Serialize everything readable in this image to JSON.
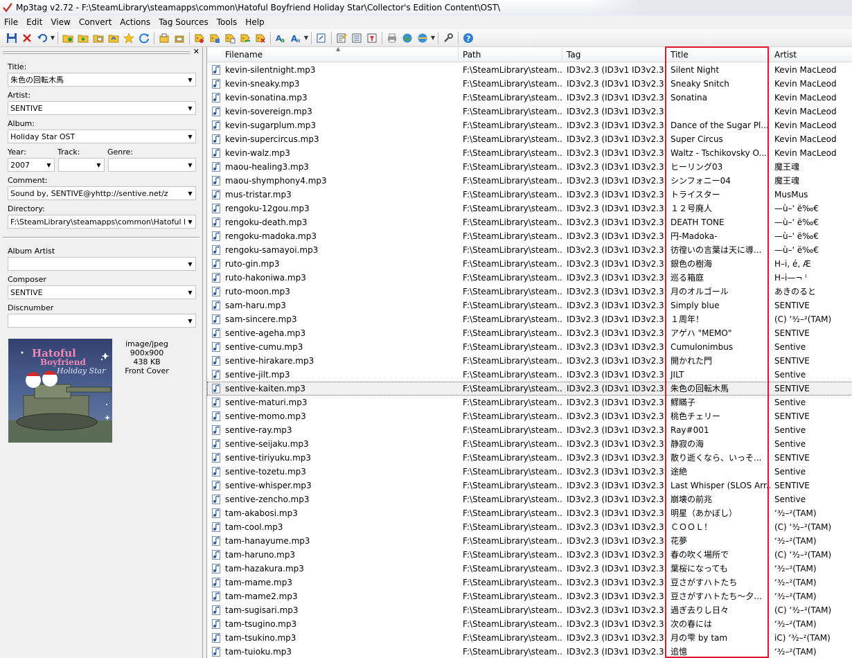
{
  "window": {
    "title": "Mp3tag v2.72  -  F:\\SteamLibrary\\steamapps\\common\\Hatoful Boyfriend Holiday Star\\Collector's Edition Content\\OST\\"
  },
  "menu": [
    "File",
    "Edit",
    "View",
    "Convert",
    "Actions",
    "Tag Sources",
    "Tools",
    "Help"
  ],
  "toolbar_icons": [
    "save-icon",
    "remove-tag-icon",
    "undo-icon",
    "add-directory-icon",
    "change-directory-icon",
    "add-files-icon",
    "favorite-icon",
    "refresh-icon",
    "copy-tag-icon",
    "paste-tag-icon",
    "tag-to-filename-icon",
    "filename-to-tag-icon",
    "text-to-tag-icon",
    "tag-to-tag-icon",
    "auto-numbering-icon",
    "actions-icon",
    "case-conversion-icon",
    "extended-tags-icon",
    "export-icon",
    "playlist-icon",
    "filter-icon",
    "print-icon",
    "web-source-icon",
    "freedb-icon",
    "options-icon",
    "help-icon"
  ],
  "colors": {
    "highlight": "#e0142c",
    "accent": "#1f6fd0"
  },
  "panel": {
    "title_label": "Title:",
    "title_value": "朱色の回転木馬",
    "artist_label": "Artist:",
    "artist_value": "SENTIVE",
    "album_label": "Album:",
    "album_value": "Holiday Star OST",
    "year_label": "Year:",
    "year_value": "2007",
    "track_label": "Track:",
    "track_value": "",
    "genre_label": "Genre:",
    "genre_value": "",
    "comment_label": "Comment:",
    "comment_value": "Sound by, SENTIVE@yhttp://sentive.net/z",
    "directory_label": "Directory:",
    "directory_value": "F:\\SteamLibrary\\steamapps\\common\\Hatoful Boyfriend",
    "album_artist_label": "Album Artist",
    "album_artist_value": "",
    "composer_label": "Composer",
    "composer_value": "SENTIVE",
    "discnumber_label": "Discnumber",
    "discnumber_value": "",
    "cover": {
      "type": "image/jpeg",
      "dimensions": "900x900",
      "size": "438 KB",
      "kind": "Front Cover",
      "art_text_1": "Hatoful",
      "art_text_2": "Boyfriend",
      "art_text_3": "Holiday Star"
    }
  },
  "columns": {
    "filename": "Filename",
    "path": "Path",
    "tag": "Tag",
    "title": "Title",
    "artist": "Artist"
  },
  "rows": [
    {
      "filename": "kevin-silentnight.mp3",
      "path": "F:\\SteamLibrary\\steam...",
      "tag": "ID3v2.3 (ID3v1 ID3v2.3)",
      "title": "Silent Night",
      "artist": "Kevin MacLeod"
    },
    {
      "filename": "kevin-sneaky.mp3",
      "path": "F:\\SteamLibrary\\steam...",
      "tag": "ID3v2.3 (ID3v1 ID3v2.3)",
      "title": "Sneaky Snitch",
      "artist": "Kevin MacLeod"
    },
    {
      "filename": "kevin-sonatina.mp3",
      "path": "F:\\SteamLibrary\\steam...",
      "tag": "ID3v2.3 (ID3v1 ID3v2.3)",
      "title": "Sonatina",
      "artist": "Kevin MacLeod"
    },
    {
      "filename": "kevin-sovereign.mp3",
      "path": "F:\\SteamLibrary\\steam...",
      "tag": "ID3v2.3 (ID3v1 ID3v2.3)",
      "title": "",
      "artist": "Kevin MacLeod"
    },
    {
      "filename": "kevin-sugarplum.mp3",
      "path": "F:\\SteamLibrary\\steam...",
      "tag": "ID3v2.3 (ID3v1 ID3v2.3...",
      "title": "Dance of the Sugar Pl...",
      "artist": "Kevin MacLeod"
    },
    {
      "filename": "kevin-supercircus.mp3",
      "path": "F:\\SteamLibrary\\steam...",
      "tag": "ID3v2.3 (ID3v1 ID3v2.3...",
      "title": "Super Circus",
      "artist": "Kevin MacLeod"
    },
    {
      "filename": "kevin-walz.mp3",
      "path": "F:\\SteamLibrary\\steam...",
      "tag": "ID3v2.3 (ID3v1 ID3v2.3)",
      "title": "Waltz - Tschikovsky O...",
      "artist": "Kevin MacLeod"
    },
    {
      "filename": "maou-healing3.mp3",
      "path": "F:\\SteamLibrary\\steam...",
      "tag": "ID3v2.3 (ID3v1 ID3v2.3)",
      "title": "ヒーリング03",
      "artist": "魔王魂"
    },
    {
      "filename": "maou-shymphony4.mp3",
      "path": "F:\\SteamLibrary\\steam...",
      "tag": "ID3v2.3 (ID3v1 ID3v2.3)",
      "title": "シンフォニー04",
      "artist": "魔王魂"
    },
    {
      "filename": "mus-tristar.mp3",
      "path": "F:\\SteamLibrary\\steam...",
      "tag": "ID3v2.3 (ID3v1 ID3v2.3)",
      "title": "トライスター",
      "artist": "MusMus"
    },
    {
      "filename": "rengoku-12gou.mp3",
      "path": "F:\\SteamLibrary\\steam...",
      "tag": "ID3v2.3 (ID3v1 ID3v2.3)",
      "title": "１２号廃人",
      "artist": "—ù–'  ë‰€"
    },
    {
      "filename": "rengoku-death.mp3",
      "path": "F:\\SteamLibrary\\steam...",
      "tag": "ID3v2.3 (ID3v1 ID3v2.3)",
      "title": "DEATH TONE",
      "artist": "—ù–'  ë‰€"
    },
    {
      "filename": "rengoku-madoka.mp3",
      "path": "F:\\SteamLibrary\\steam...",
      "tag": "ID3v2.3 (ID3v1 ID3v2.3)",
      "title": "円-Madoka-",
      "artist": "—ù–'  ë‰€"
    },
    {
      "filename": "rengoku-samayoi.mp3",
      "path": "F:\\SteamLibrary\\steam...",
      "tag": "ID3v2.3 (ID3v1 ID3v2.3)",
      "title": "彷徨いの言葉は天に導...",
      "artist": "—ù–'  ë‰€"
    },
    {
      "filename": "ruto-gin.mp3",
      "path": "F:\\SteamLibrary\\steam...",
      "tag": "ID3v2.3 (ID3v1 ID3v2.3)",
      "title": "銀色の樹海",
      "artist": "H–i, é, Æ"
    },
    {
      "filename": "ruto-hakoniwa.mp3",
      "path": "F:\\SteamLibrary\\steam...",
      "tag": "ID3v2.3 (ID3v1 ID3v2.3)",
      "title": "巡る箱庭",
      "artist": "H–i—¬  ˡ"
    },
    {
      "filename": "ruto-moon.mp3",
      "path": "F:\\SteamLibrary\\steam...",
      "tag": "ID3v2.3 (ID3v1 ID3v2.3)",
      "title": "月のオルゴール",
      "artist": "あきのると"
    },
    {
      "filename": "sam-haru.mp3",
      "path": "F:\\SteamLibrary\\steam...",
      "tag": "ID3v2.3 (ID3v1 ID3v2.3)",
      "title": "Simply blue",
      "artist": "SENTIVE"
    },
    {
      "filename": "sam-sincere.mp3",
      "path": "F:\\SteamLibrary\\steam...",
      "tag": "ID3v2.3 (ID3v1 ID3v2.3)",
      "title": "１周年！",
      "artist": "(C)  ʻ³⁄₂–²(TAM)"
    },
    {
      "filename": "sentive-ageha.mp3",
      "path": "F:\\SteamLibrary\\steam...",
      "tag": "ID3v2.3 (ID3v1 ID3v2.3)",
      "title": "アゲハ  \"MEMO\"",
      "artist": "SENTIVE"
    },
    {
      "filename": "sentive-cumu.mp3",
      "path": "F:\\SteamLibrary\\steam...",
      "tag": "ID3v2.3 (ID3v1 ID3v2.3)",
      "title": "Cumulonimbus",
      "artist": "Sentive"
    },
    {
      "filename": "sentive-hirakare.mp3",
      "path": "F:\\SteamLibrary\\steam...",
      "tag": "ID3v2.3 (ID3v1 ID3v2.3)",
      "title": "開かれた門",
      "artist": "SENTIVE"
    },
    {
      "filename": "sentive-jilt.mp3",
      "path": "F:\\SteamLibrary\\steam...",
      "tag": "ID3v2.3 (ID3v1 ID3v2.3)",
      "title": "JILT",
      "artist": "Sentive"
    },
    {
      "filename": "sentive-kaiten.mp3",
      "path": "F:\\SteamLibrary\\steam...",
      "tag": "ID3v2.3 (ID3v1 ID3v2.3)",
      "title": "朱色の回転木馬",
      "artist": "SENTIVE",
      "selected": true
    },
    {
      "filename": "sentive-maturi.mp3",
      "path": "F:\\SteamLibrary\\steam...",
      "tag": "ID3v2.3 (ID3v1 ID3v2.3)",
      "title": "鰥瞞子",
      "artist": "Sentive"
    },
    {
      "filename": "sentive-momo.mp3",
      "path": "F:\\SteamLibrary\\steam...",
      "tag": "ID3v2.3 (ID3v1 ID3v2.3)",
      "title": "桃色チェリー",
      "artist": "SENTIVE"
    },
    {
      "filename": "sentive-ray.mp3",
      "path": "F:\\SteamLibrary\\steam...",
      "tag": "ID3v2.3 (ID3v1 ID3v2.3)",
      "title": "Ray#001",
      "artist": "Sentive"
    },
    {
      "filename": "sentive-seijaku.mp3",
      "path": "F:\\SteamLibrary\\steam...",
      "tag": "ID3v2.3 (ID3v1 ID3v2.3)",
      "title": "静寂の海",
      "artist": "Sentive"
    },
    {
      "filename": "sentive-tiriyuku.mp3",
      "path": "F:\\SteamLibrary\\steam...",
      "tag": "ID3v2.3 (ID3v1 ID3v2.3)",
      "title": "散り逝くなら、いっそ...",
      "artist": "SENTIVE"
    },
    {
      "filename": "sentive-tozetu.mp3",
      "path": "F:\\SteamLibrary\\steam...",
      "tag": "ID3v2.3 (ID3v1 ID3v2.3)",
      "title": "途絶",
      "artist": "Sentive"
    },
    {
      "filename": "sentive-whisper.mp3",
      "path": "F:\\SteamLibrary\\steam...",
      "tag": "ID3v2.3 (ID3v1 ID3v2.3)",
      "title": "Last Whisper (SLOS Arr...",
      "artist": "SENTIVE"
    },
    {
      "filename": "sentive-zencho.mp3",
      "path": "F:\\SteamLibrary\\steam...",
      "tag": "ID3v2.3 (ID3v1 ID3v2.3)",
      "title": "崩壊の前兆",
      "artist": "Sentive"
    },
    {
      "filename": "tam-akabosi.mp3",
      "path": "F:\\SteamLibrary\\steam...",
      "tag": "ID3v2.3 (ID3v1 ID3v2.3)",
      "title": "明星（あかぼし）",
      "artist": "  ʻ³⁄₂–²(TAM)"
    },
    {
      "filename": "tam-cool.mp3",
      "path": "F:\\SteamLibrary\\steam...",
      "tag": "ID3v2.3 (ID3v1 ID3v2.3)",
      "title": "ＣＯＯＬ！",
      "artist": "(C)  ʻ³⁄₂–²(TAM)"
    },
    {
      "filename": "tam-hanayume.mp3",
      "path": "F:\\SteamLibrary\\steam...",
      "tag": "ID3v2.3 (ID3v1 ID3v2.3)",
      "title": "花夢",
      "artist": "  ʻ³⁄₂–²(TAM)"
    },
    {
      "filename": "tam-haruno.mp3",
      "path": "F:\\SteamLibrary\\steam...",
      "tag": "ID3v2.3 (ID3v1 ID3v2.3)",
      "title": "春の吹く場所で",
      "artist": "(C)  ʻ³⁄₂–²(TAM)"
    },
    {
      "filename": "tam-hazakura.mp3",
      "path": "F:\\SteamLibrary\\steam...",
      "tag": "ID3v2.3 (ID3v1 ID3v2.3)",
      "title": "葉桜になっても",
      "artist": "  ʻ³⁄₂–²(TAM)"
    },
    {
      "filename": "tam-mame.mp3",
      "path": "F:\\SteamLibrary\\steam...",
      "tag": "ID3v2.3 (ID3v1 ID3v2.3)",
      "title": "豆さがすハトたち",
      "artist": "  ʻ³⁄₂–²(TAM)"
    },
    {
      "filename": "tam-mame2.mp3",
      "path": "F:\\SteamLibrary\\steam...",
      "tag": "ID3v2.3 (ID3v1 ID3v2.3)",
      "title": "豆さがすハトたち～夕...",
      "artist": "  ʻ³⁄₂–²(TAM)"
    },
    {
      "filename": "tam-sugisari.mp3",
      "path": "F:\\SteamLibrary\\steam...",
      "tag": "ID3v2.3 (ID3v1 ID3v2.3)",
      "title": "過ぎ去りし日々",
      "artist": "(C)  ʻ³⁄₂–²(TAM)"
    },
    {
      "filename": "tam-tsugino.mp3",
      "path": "F:\\SteamLibrary\\steam...",
      "tag": "ID3v2.3 (ID3v1 ID3v2.3)",
      "title": "次の春には",
      "artist": "  ʻ³⁄₂–²(TAM)"
    },
    {
      "filename": "tam-tsukino.mp3",
      "path": "F:\\SteamLibrary\\steam...",
      "tag": "ID3v2.3 (ID3v1 ID3v2.3)",
      "title": "月の雫  by tam",
      "artist": "iC)  ʻ³⁄₂–²(TAM)"
    },
    {
      "filename": "tam-tuioku.mp3",
      "path": "F:\\SteamLibrary\\steam...",
      "tag": "ID3v2.3 (ID3v1 ID3v2.3)",
      "title": "追憶",
      "artist": "  ʻ³⁄₂–²(TAM)"
    }
  ]
}
